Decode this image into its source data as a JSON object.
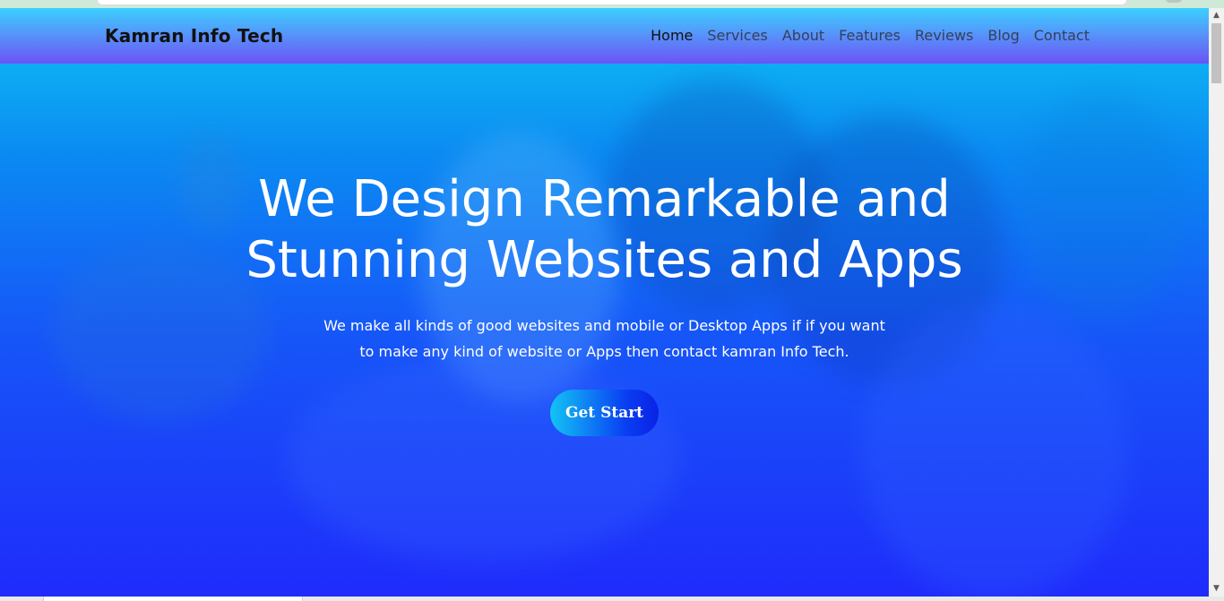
{
  "nav": {
    "brand": "Kamran Info Tech",
    "links": [
      "Home",
      "Services",
      "About",
      "Features",
      "Reviews",
      "Blog",
      "Contact"
    ],
    "active": "Home"
  },
  "hero": {
    "title_line1": "We Design Remarkable and",
    "title_line2": "Stunning Websites and Apps",
    "subtitle_line1": "We make all kinds of good websites and mobile or Desktop Apps if if you want",
    "subtitle_line2": "to make any kind of website or Apps then contact kamran Info Tech.",
    "cta_label": "Get Start"
  },
  "colors": {
    "navbar_top": "#3bd0ff",
    "navbar_bottom": "#6a53f6",
    "hero_top": "#0fc3f5",
    "hero_bottom": "#1f2bfb",
    "cta_start": "#12c4f5",
    "cta_end": "#0a22e6"
  },
  "icons": {
    "scroll_up": "▲",
    "scroll_down": "▼"
  }
}
